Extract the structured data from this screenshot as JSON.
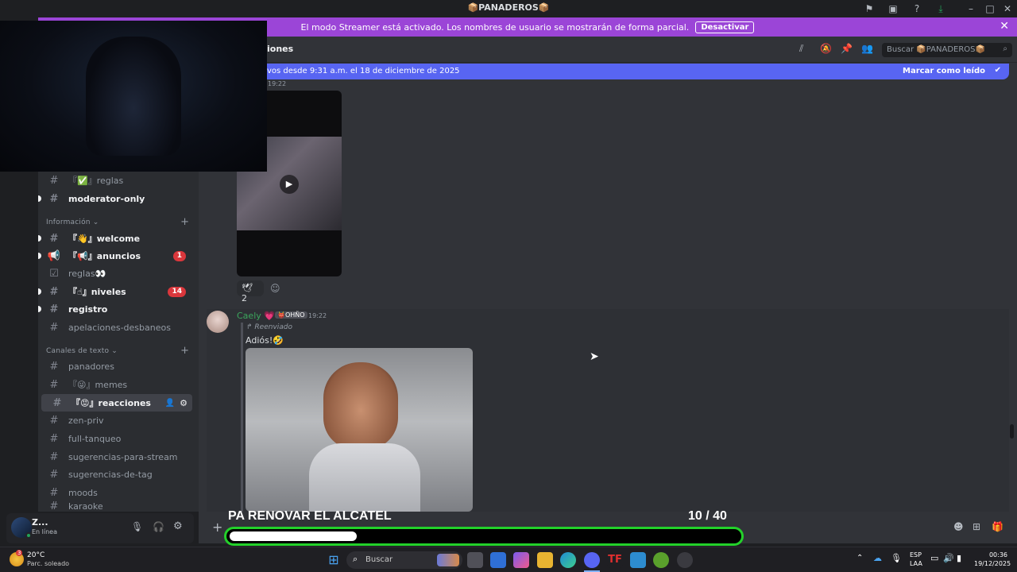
{
  "window": {
    "title": "📦PANADEROS📦"
  },
  "banner": {
    "text": "El modo Streamer está activado. Los nombres de usuario se mostrarán de forma parcial.",
    "deactivate": "Desactivar"
  },
  "header": {
    "channel": "iones",
    "search_placeholder": "Buscar 📦PANADEROS📦"
  },
  "new_messages": {
    "text": "vos desde 9:31 a.m. el 18 de diciembre de 2025",
    "mark_read": "Marcar como leído"
  },
  "sidebar": {
    "channels_top": [
      {
        "name": "『✅』reglas",
        "bold": false
      },
      {
        "name": "moderator-only",
        "bold": true
      }
    ],
    "category_info": "Información",
    "info_channels": [
      {
        "name": "『👋』welcome",
        "bold": true,
        "badge": ""
      },
      {
        "name": "『📢』anuncios",
        "bold": true,
        "badge": "1"
      },
      {
        "name": "reglas👀",
        "bold": false,
        "badge": ""
      },
      {
        "name": "『☝』niveles",
        "bold": true,
        "badge": "14"
      },
      {
        "name": "registro",
        "bold": true,
        "badge": ""
      },
      {
        "name": "apelaciones-desbaneos",
        "bold": false,
        "badge": ""
      }
    ],
    "category_text": "Canales de texto",
    "text_channels": [
      {
        "name": "panadores",
        "bold": false
      },
      {
        "name": "『😜』memes",
        "bold": false
      },
      {
        "name": "『😡』reacciones",
        "bold": true,
        "selected": true
      },
      {
        "name": "zen-priv",
        "bold": false
      },
      {
        "name": "full-tanqueo",
        "bold": false
      },
      {
        "name": "sugerencias-para-stream",
        "bold": false
      },
      {
        "name": "sugerencias-de-tag",
        "bold": false
      },
      {
        "name": "moods",
        "bold": false
      },
      {
        "name": "karaoke",
        "bold": false
      }
    ]
  },
  "user": {
    "name": "Z...",
    "status": "En línea"
  },
  "messages": {
    "first_time": "19:22",
    "reaction_count": "2",
    "author": "Caely 💗",
    "author_tag": "👹OHÑO",
    "time": "19:22",
    "forwarded": "Reenviado",
    "text": "Adiós!🤣"
  },
  "overlay": {
    "caption": "PA RENOVAR EL ALCATEL",
    "counter_current": "10",
    "counter_total": "/ 40",
    "progress": 0.25
  },
  "taskbar": {
    "weather_temp": "20°C",
    "weather_desc": "Parc. soleado",
    "search": "Buscar",
    "lang1": "ESP",
    "lang2": "LAA",
    "time": "00:36",
    "date": "19/12/2025",
    "notif": "3"
  },
  "colors": {
    "accent": "#5865f2",
    "streamer": "#9b45d7",
    "progress": "#23d12a"
  }
}
